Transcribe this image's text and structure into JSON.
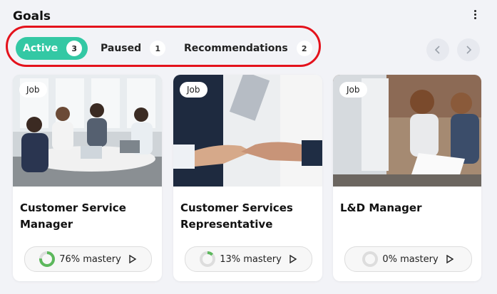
{
  "header": {
    "title": "Goals",
    "menu_icon": "kebab-menu-icon"
  },
  "tabs": [
    {
      "label": "Active",
      "count": "3",
      "selected": true
    },
    {
      "label": "Paused",
      "count": "1",
      "selected": false
    },
    {
      "label": "Recommendations",
      "count": "2",
      "selected": false
    }
  ],
  "nav": {
    "prev_icon": "chevron-left-icon",
    "next_icon": "chevron-right-icon"
  },
  "colors": {
    "accent": "#33c8a4",
    "highlight": "#e4121c",
    "mastery_ring": "#5cb85c"
  },
  "cards": [
    {
      "badge": "Job",
      "title": "Customer Service Manager",
      "mastery_label": "76% mastery",
      "mastery": 0.76,
      "image": "team-meeting-photo"
    },
    {
      "badge": "Job",
      "title": "Customer Services Representative",
      "mastery_label": "13% mastery",
      "mastery": 0.13,
      "image": "handshake-photo"
    },
    {
      "badge": "Job",
      "title": "L&D Manager",
      "mastery_label": "0% mastery",
      "mastery": 0.0,
      "image": "office-workers-photo"
    }
  ]
}
